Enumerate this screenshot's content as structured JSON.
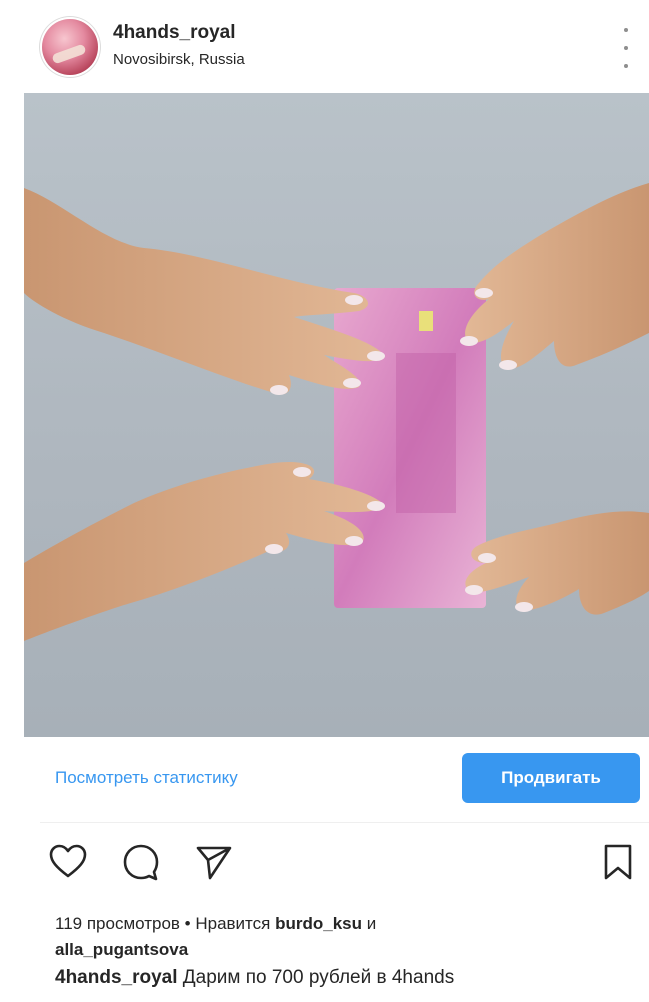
{
  "post": {
    "username": "4hands_royal",
    "location": "Novosibirsk, Russia"
  },
  "icons": {
    "more": "more-options-icon",
    "like": "heart-icon",
    "comment": "comment-icon",
    "share": "send-icon",
    "save": "bookmark-icon"
  },
  "promo": {
    "stats_link": "Посмотреть статистику",
    "promote_button": "Продвигать"
  },
  "engagement": {
    "views": "119 просмотров",
    "separator": " • ",
    "liked_by_prefix": "Нравится ",
    "liked_user_1": "burdo_ksu",
    "and": " и",
    "liked_user_2": "alla_pugantsova"
  },
  "caption": {
    "author": "4hands_royal",
    "text": " Дарим по 700 рублей в 4hands"
  },
  "colors": {
    "accent": "#3897f0",
    "text": "#262626"
  }
}
